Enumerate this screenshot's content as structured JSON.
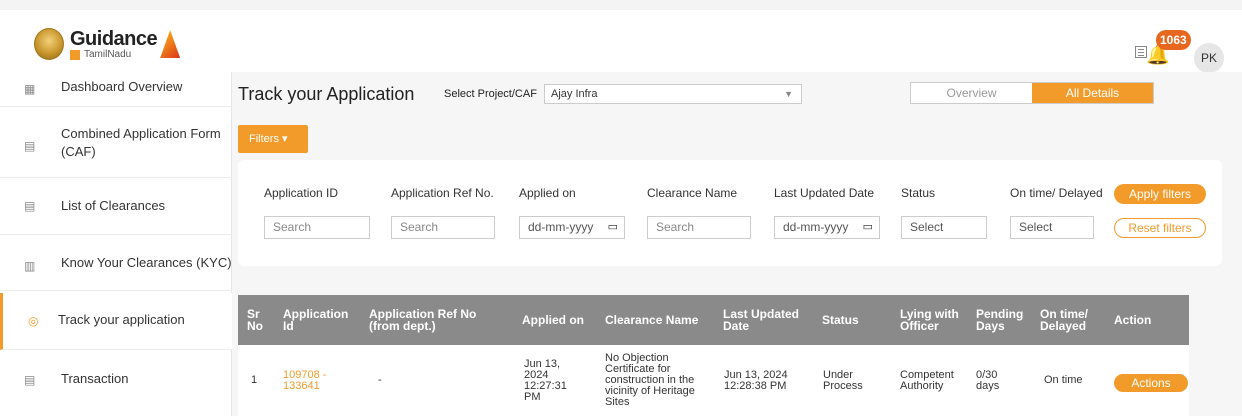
{
  "header": {
    "logo_main": "Guidance",
    "logo_sub": "TamilNadu",
    "notification_count": "1063",
    "avatar_initials": "PK"
  },
  "sidebar": {
    "items": [
      {
        "label": "Dashboard Overview",
        "icon": "dashboard-icon"
      },
      {
        "label": "Combined Application Form (CAF)",
        "icon": "document-icon"
      },
      {
        "label": "List of Clearances",
        "icon": "list-icon"
      },
      {
        "label": "Know Your Clearances (KYC)",
        "icon": "book-icon"
      },
      {
        "label": "Track your application",
        "icon": "location-pin-icon",
        "active": true
      },
      {
        "label": "Transaction",
        "icon": "transaction-icon"
      }
    ]
  },
  "page": {
    "title": "Track your Application",
    "select_label": "Select Project/CAF",
    "selected_project": "Ajay Infra",
    "toggle": {
      "overview": "Overview",
      "all_details": "All Details",
      "active": "all_details"
    },
    "filters_label": "Filters"
  },
  "filters": {
    "application_id": {
      "label": "Application ID",
      "placeholder": "Search"
    },
    "application_ref": {
      "label": "Application Ref No.",
      "placeholder": "Search"
    },
    "applied_on": {
      "label": "Applied on",
      "value": "dd-mm-yyyy"
    },
    "clearance_name": {
      "label": "Clearance Name",
      "placeholder": "Search"
    },
    "last_updated": {
      "label": "Last Updated Date",
      "value": "dd-mm-yyyy"
    },
    "status": {
      "label": "Status",
      "value": "Select"
    },
    "on_time": {
      "label": "On time/ Delayed",
      "value": "Select"
    },
    "apply_label": "Apply filters",
    "reset_label": "Reset filters"
  },
  "table": {
    "headers": {
      "sr_no": "Sr No",
      "application_id": "Application Id",
      "application_ref": "Application Ref No (from dept.)",
      "applied_on": "Applied on",
      "clearance_name": "Clearance Name",
      "last_updated": "Last Updated Date",
      "status": "Status",
      "lying_with": "Lying with Officer",
      "pending_days": "Pending Days",
      "on_time": "On time/ Delayed",
      "action": "Action"
    },
    "rows": [
      {
        "sr_no": "1",
        "application_id": "109708 - 133641",
        "application_ref": "-",
        "applied_on": "Jun 13, 2024 12:27:31 PM",
        "clearance_name": "No Objection Certificate for construction in the vicinity of Heritage Sites",
        "last_updated": "Jun 13, 2024 12:28:38 PM",
        "status": "Under Process",
        "lying_with": "Competent Authority",
        "pending_days": "0/30 days",
        "on_time": "On time",
        "action": "Actions"
      }
    ]
  },
  "colors": {
    "accent": "#f29b2a",
    "table_header": "#8a8a8a"
  }
}
